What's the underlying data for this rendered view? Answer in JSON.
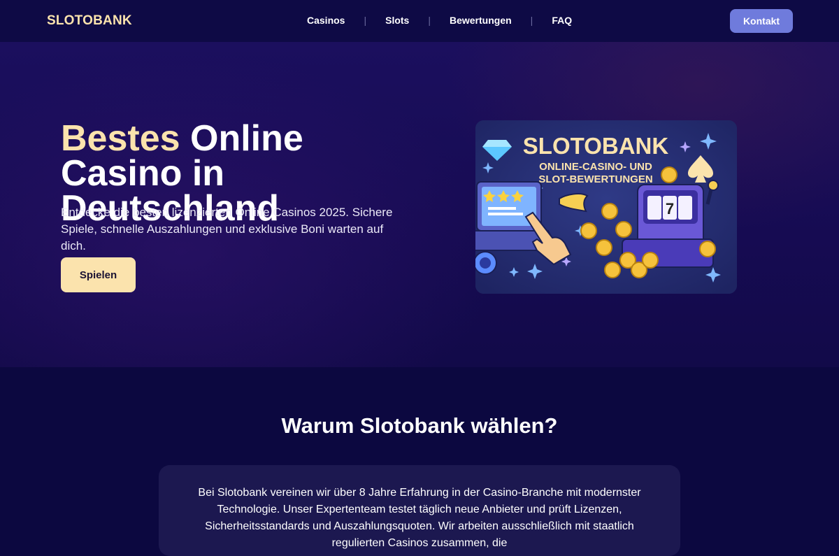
{
  "header": {
    "logo": "SLOTOBANK",
    "nav": [
      {
        "label": "Casinos"
      },
      {
        "label": "Slots"
      },
      {
        "label": "Bewertungen"
      },
      {
        "label": "FAQ"
      }
    ],
    "separator": "|",
    "contact_label": "Kontakt"
  },
  "hero": {
    "title_accent": "Bestes",
    "title_rest": " Online Casino in Deutschland",
    "subtitle": "Entdecke die besten lizenzierten Online Casinos 2025. Sichere Spiele, schnelle Auszahlungen und exklusive Boni warten auf dich.",
    "cta_label": "Spielen",
    "image": {
      "brand": "SLOTOBANK",
      "line1": "ONLINE-CASINO- UND",
      "line2": "SLOT-BEWERTUNGEN",
      "reel_symbol": "7"
    }
  },
  "why": {
    "title": "Warum Slotobank wählen?",
    "text": "Bei Slotobank vereinen wir über 8 Jahre Erfahrung in der Casino-Branche mit modernster Technologie. Unser Expertenteam testet täglich neue Anbieter und prüft Lizenzen, Sicherheitsstandards und Auszahlungsquoten. Wir arbeiten ausschließlich mit staatlich regulierten Casinos zusammen, die"
  },
  "colors": {
    "accent": "#fbe3ad",
    "button_blue": "#6f7bdc",
    "background": "#0c0840",
    "card": "#1c1850"
  }
}
